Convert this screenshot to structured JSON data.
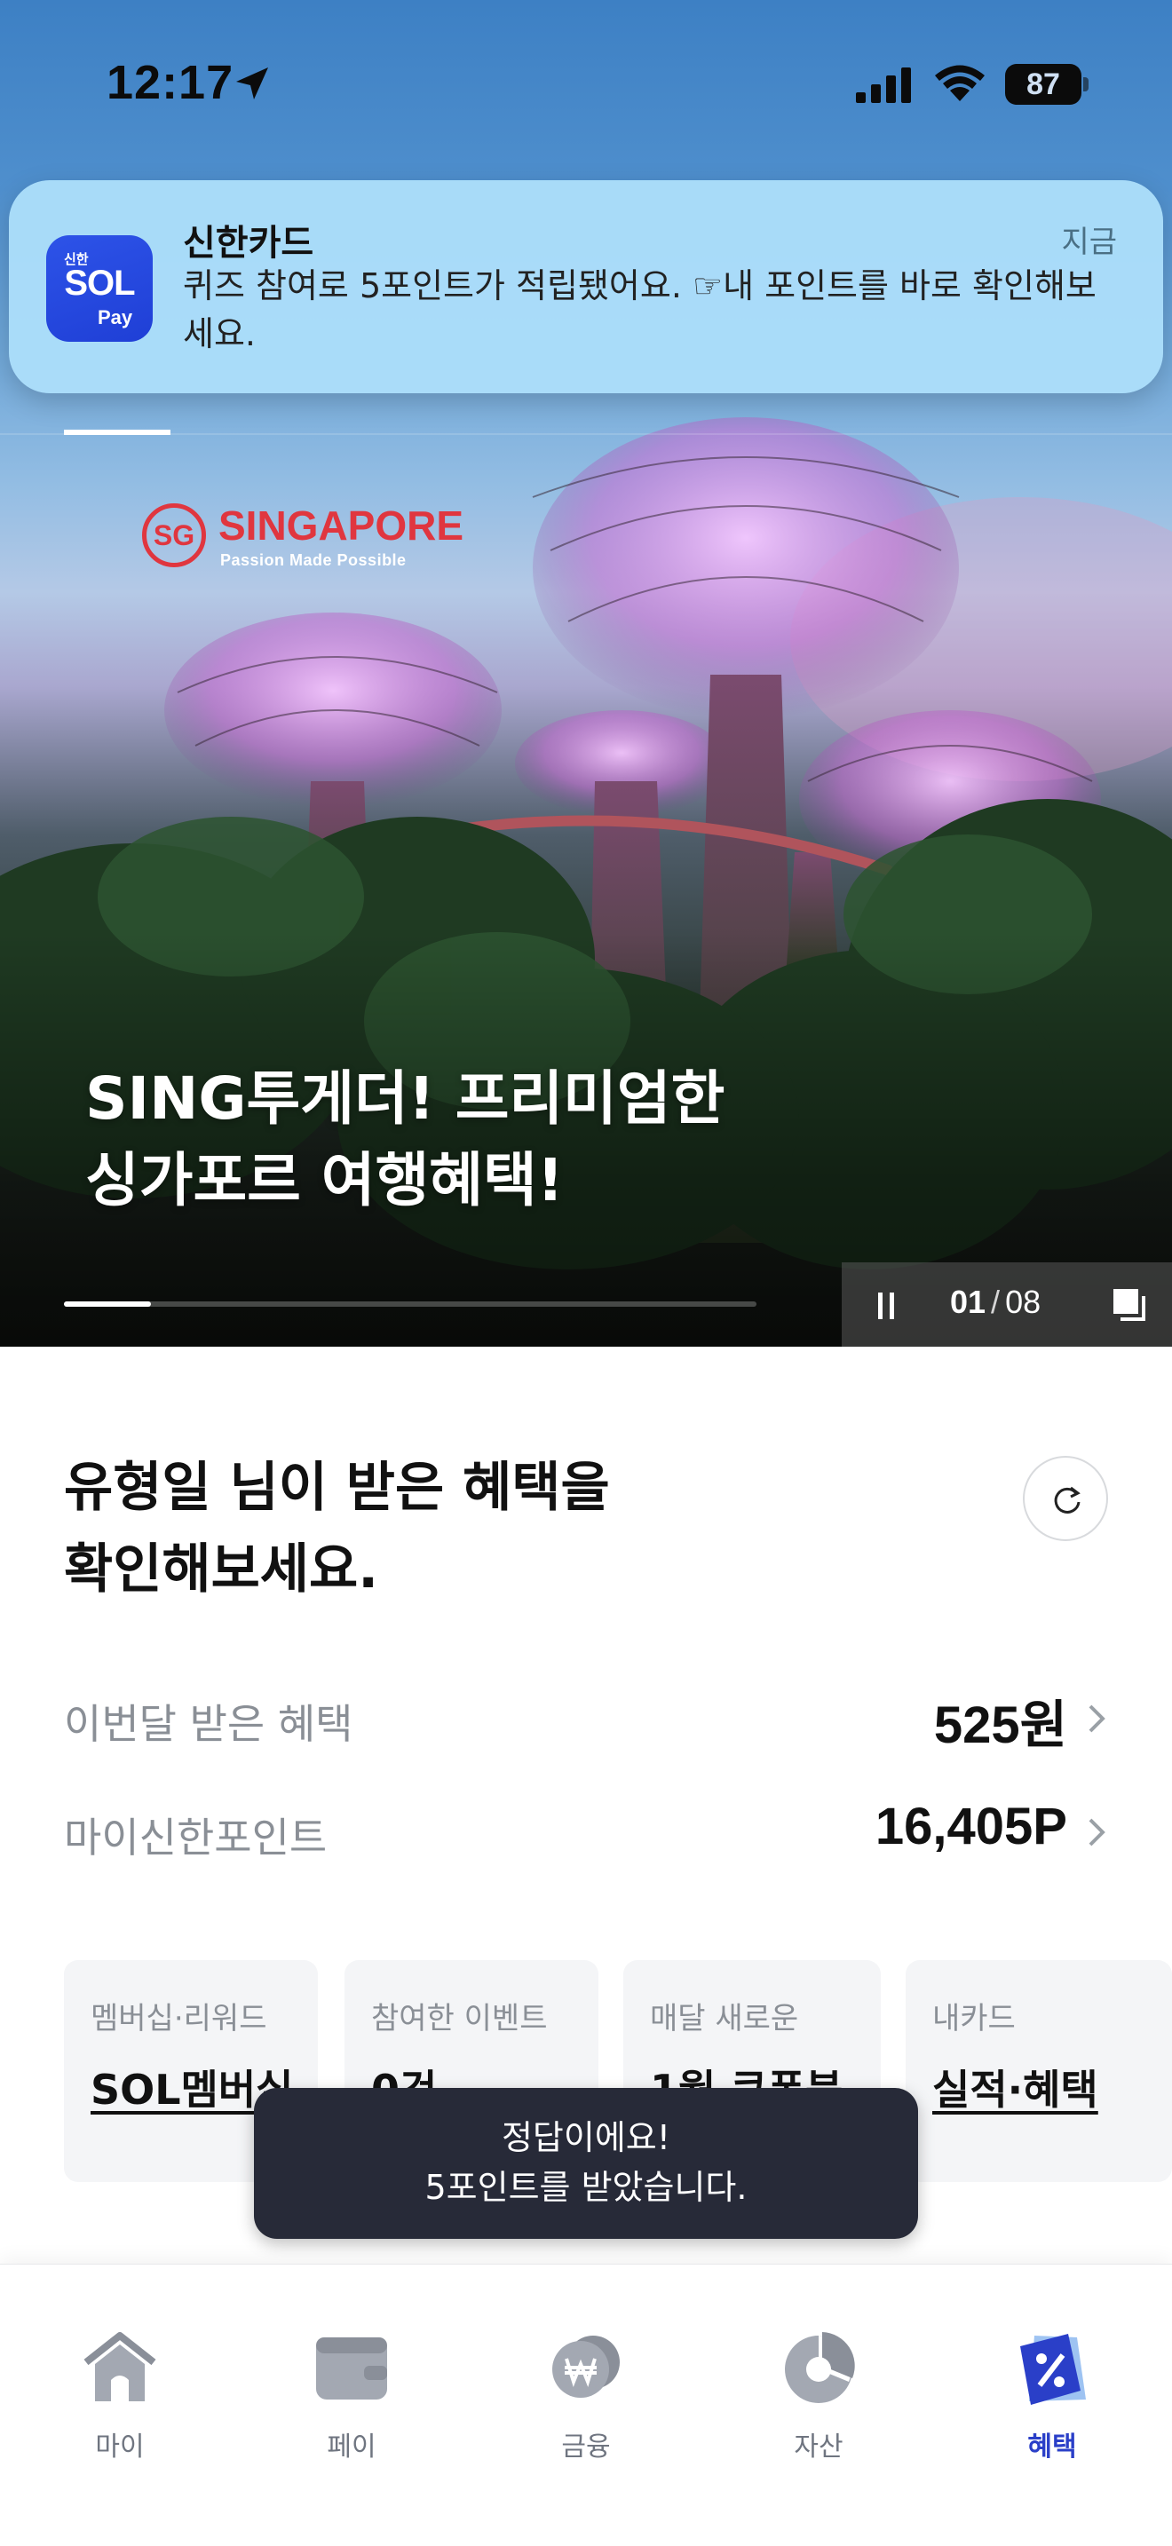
{
  "status_bar": {
    "time": "12:17",
    "battery": "87"
  },
  "notification": {
    "app_name": "신한카드",
    "time": "지금",
    "body": "퀴즈 참여로 5포인트가 적립됐어요. ☞내 포인트를 바로 확인해보세요.",
    "icon_text_top": "신한",
    "icon_text_main": "SOL",
    "icon_text_bottom": "Pay"
  },
  "banner": {
    "brand_word": "SINGAPORE",
    "brand_mark": "SG",
    "brand_tagline": "Passion Made Possible",
    "title": "SING투게더! 프리미엄한\n싱가포르 여행혜택!",
    "current": "01",
    "total": "08",
    "progress": 0.125
  },
  "benefits": {
    "greeting": "유형일 님이 받은 혜택을\n확인해보세요.",
    "monthly_label": "이번달 받은 혜택",
    "monthly_value": "525원",
    "points_label": "마이신한포인트",
    "points_value": "16,405P",
    "cards": [
      {
        "label": "멤버십·리워드",
        "value": "SOL멤버십"
      },
      {
        "label": "참여한 이벤트",
        "value": "0건"
      },
      {
        "label": "매달 새로운",
        "value": "1월 쿠폰북"
      },
      {
        "label": "내카드",
        "value": "실적·혜택"
      }
    ]
  },
  "toast": {
    "message": "정답이에요!\n5포인트를 받았습니다."
  },
  "bottom_nav": {
    "items": [
      {
        "label": "마이",
        "icon": "house-icon"
      },
      {
        "label": "페이",
        "icon": "wallet-icon"
      },
      {
        "label": "금융",
        "icon": "won-coin-icon"
      },
      {
        "label": "자산",
        "icon": "pie-chart-icon"
      },
      {
        "label": "혜택",
        "icon": "coupon-icon",
        "active": true
      }
    ]
  },
  "colors": {
    "accent": "#2a3fc8",
    "toast_bg": "#272a38",
    "notification_bg": "#acdefa",
    "brand_red": "#e0363f"
  }
}
